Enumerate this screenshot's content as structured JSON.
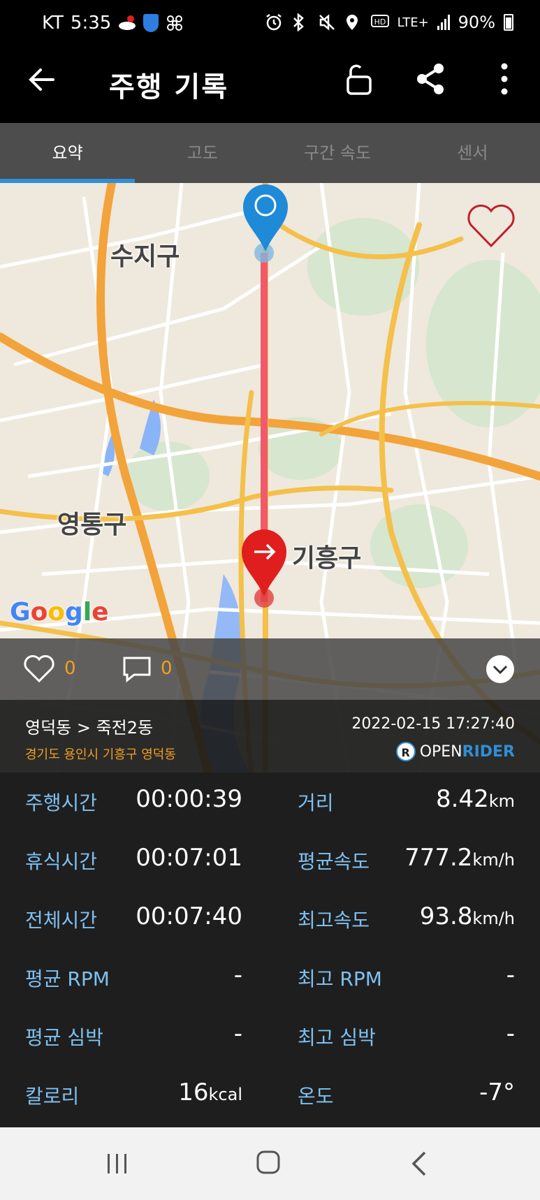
{
  "status_bar": {
    "carrier": "KT",
    "time": "5:35",
    "network": "LTE+",
    "battery": "90%"
  },
  "app_bar": {
    "title": "주행 기록"
  },
  "tabs": [
    {
      "label": "요약",
      "active": true
    },
    {
      "label": "고도",
      "active": false
    },
    {
      "label": "구간 속도",
      "active": false
    },
    {
      "label": "센서",
      "active": false
    }
  ],
  "map": {
    "labels": {
      "suji": "수지구",
      "yeongtong": "영통구",
      "giheung": "기흥구"
    },
    "attribution": "Google"
  },
  "social": {
    "likes": "0",
    "comments": "0"
  },
  "route": {
    "name": "영덕동 > 죽전2동",
    "address": "경기도 용인시 기흥구 영덕동",
    "datetime": "2022-02-15 17:27:40",
    "brand_open": "OPEN",
    "brand_rider": "RIDER",
    "brand_logo_letter": "R"
  },
  "stats": {
    "riding_time": {
      "label": "주행시간",
      "value": "00:00:39"
    },
    "distance": {
      "label": "거리",
      "value": "8.42",
      "unit": "km"
    },
    "rest_time": {
      "label": "휴식시간",
      "value": "00:07:01"
    },
    "avg_speed": {
      "label": "평균속도",
      "value": "777.2",
      "unit": "km/h"
    },
    "total_time": {
      "label": "전체시간",
      "value": "00:07:40"
    },
    "max_speed": {
      "label": "최고속도",
      "value": "93.8",
      "unit": "km/h"
    },
    "avg_rpm": {
      "label": "평균 RPM",
      "value": "-"
    },
    "max_rpm": {
      "label": "최고 RPM",
      "value": "-"
    },
    "avg_hr": {
      "label": "평균 심박",
      "value": "-"
    },
    "max_hr": {
      "label": "최고 심박",
      "value": "-"
    },
    "calories": {
      "label": "칼로리",
      "value": "16",
      "unit": "kcal"
    },
    "temperature": {
      "label": "온도",
      "value": "-7°"
    }
  },
  "colors": {
    "accent": "#2f8fd6",
    "orange": "#f0a020",
    "stat_label": "#7fc0f0",
    "route_line": "#f05a6a",
    "start_pin": "#1e8ad8",
    "end_pin": "#e01e1e"
  }
}
